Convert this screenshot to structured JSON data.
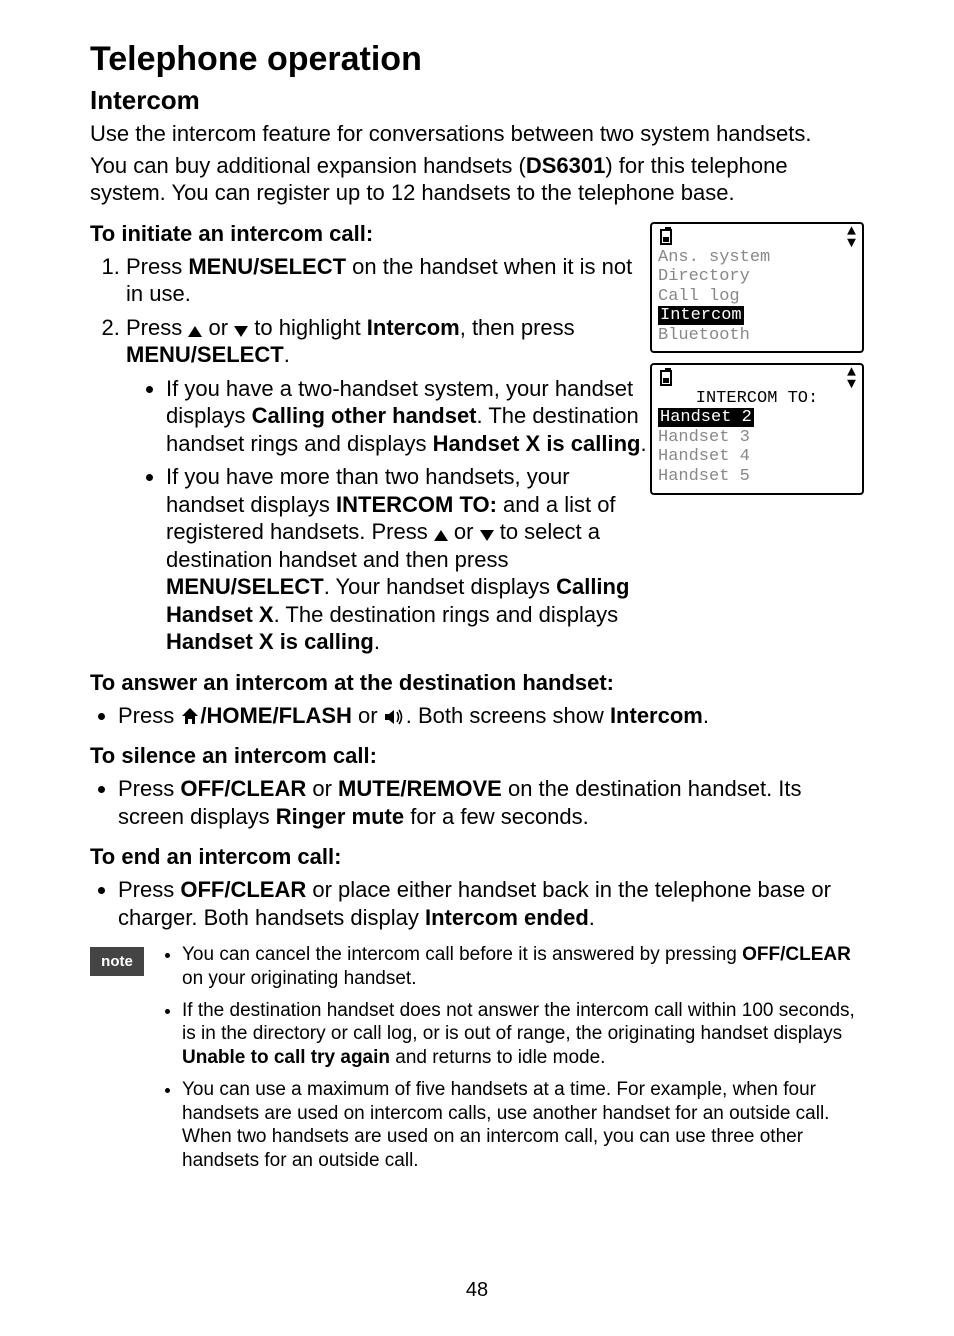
{
  "title": "Telephone operation",
  "subtitle": "Intercom",
  "intro1": "Use the intercom feature for conversations between two system handsets.",
  "intro2_a": "You can buy additional expansion handsets (",
  "intro2_model": "DS6301",
  "intro2_b": ") for this telephone system. You can register up to 12 handsets to the telephone base.",
  "heading_initiate": "To initiate an intercom call:",
  "step1_a": "Press ",
  "step1_b": "MENU/",
  "step1_c": "SELECT",
  "step1_d": " on the handset when it is not in use.",
  "step2_a": "Press ",
  "step2_or": " or ",
  "step2_b": " to highlight ",
  "step2_c": "Intercom",
  "step2_d": ", then press ",
  "step2_e": "MENU",
  "step2_f": "/SELECT",
  "step2_g": ".",
  "sub1_a": "If you have a two-handset system, your handset displays ",
  "sub1_b": "Calling other handset",
  "sub1_c": ". The destination handset rings and displays ",
  "sub1_d": "Handset X is calling",
  "sub1_e": ".",
  "sub2_a": "If you have more than two handsets, your handset displays ",
  "sub2_b": "INTERCOM TO:",
  "sub2_c": " and a list of registered handsets. Press ",
  "sub2_d": " or ",
  "sub2_e": " to select a destination handset and then press ",
  "sub2_f": "MENU",
  "sub2_g": "/SELECT",
  "sub2_h": ". Your handset displays ",
  "sub2_i": "Calling Handset X",
  "sub2_j": ". The destination rings and displays ",
  "sub2_k": "Handset X is calling",
  "sub2_l": ".",
  "heading_answer": "To answer an intercom at the destination handset:",
  "answer_a": "Press ",
  "answer_b": "/HOME/FLASH",
  "answer_c": " or ",
  "answer_d": ". Both screens show ",
  "answer_e": "Intercom",
  "answer_f": ".",
  "heading_silence": "To silence an intercom call:",
  "silence_a": "Press ",
  "silence_b": "OFF/",
  "silence_c": "CLEAR",
  "silence_d": " or ",
  "silence_e": "MUTE/",
  "silence_f": "REMOVE",
  "silence_g": " on the destination handset. Its screen displays ",
  "silence_h": "Ringer mute",
  "silence_i": " for a few seconds.",
  "heading_end": "To end an intercom call:",
  "end_a": "Press ",
  "end_b": "OFF/",
  "end_c": "CLEAR",
  "end_d": " or place either handset back in the telephone base or charger. Both handsets display ",
  "end_e": "Intercom ended",
  "end_f": ".",
  "note_label": "note",
  "note1_a": "You can cancel the intercom call before it is answered by pressing ",
  "note1_b": "OFF/",
  "note1_c": "CLEAR",
  "note1_d": " on your originating handset.",
  "note2_a": "If the destination handset does not answer the intercom call within 100 seconds, is in the directory or call log, or is out of range, the originating handset displays ",
  "note2_b": "Unable to call try again",
  "note2_c": " and returns to idle mode.",
  "note3": "You can use a maximum of five handsets at a time. For example, when four handsets are used on intercom calls, use another handset for an outside call. When two handsets are used on an intercom call, you can use three other handsets for an outside call.",
  "page": "48",
  "lcd1": {
    "l1": "Ans. system",
    "l2": "Directory",
    "l3": "Call log",
    "sel": "Intercom",
    "l5": "Bluetooth"
  },
  "lcd2": {
    "title": "INTERCOM TO:",
    "sel": "Handset 2",
    "l2": "Handset 3",
    "l3": "Handset 4",
    "l4": "Handset 5"
  }
}
